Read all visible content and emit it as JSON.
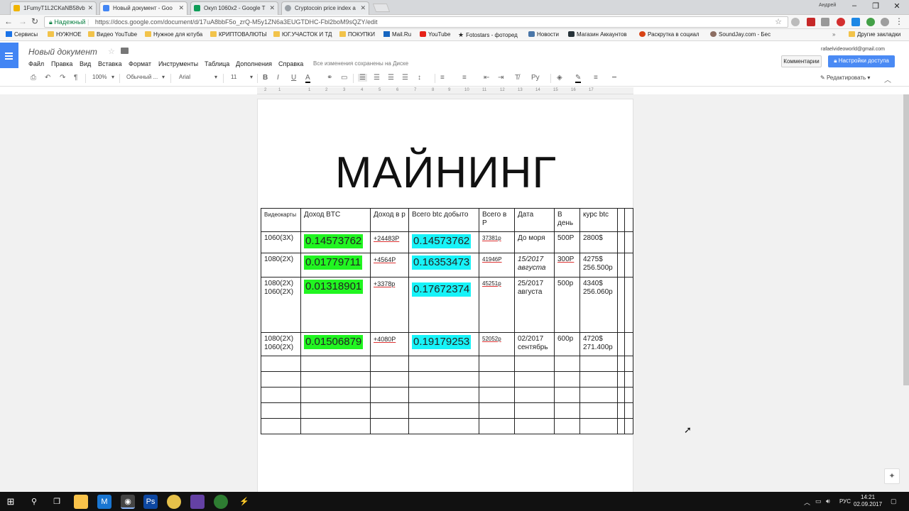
{
  "browser": {
    "tabs": [
      {
        "label": "1FumyT1L2CKaNB58vb",
        "color": "#f0b400"
      },
      {
        "label": "Новый документ - Goo",
        "color": "#4285f4"
      },
      {
        "label": "Окуп 1060x2 - Google T",
        "color": "#0f9d58"
      },
      {
        "label": "Cryptocoin price index a",
        "color": "#9aa0a6"
      }
    ],
    "user_name": "Андрей",
    "secure_label": "Надежный",
    "url": "https://docs.google.com/document/d/17uA8bbF5o_zrQ-M5y1ZN6a3EUGTDHC-Fbl2boM9sQZY/edit"
  },
  "bookmarks": [
    {
      "label": "Сервисы",
      "icon": "apps-icon"
    },
    {
      "label": "НУЖНОЕ",
      "icon": "folder-icon"
    },
    {
      "label": "Видео YouTube",
      "icon": "folder-icon"
    },
    {
      "label": "Нужное для ютуба",
      "icon": "folder-icon"
    },
    {
      "label": "КРИПТОВАЛЮТЫ",
      "icon": "folder-icon"
    },
    {
      "label": "ЮГ.УЧАСТОК И ТД",
      "icon": "folder-icon"
    },
    {
      "label": "ПОКУПКИ",
      "icon": "folder-icon"
    },
    {
      "label": "Mail.Ru",
      "icon": "mail-icon"
    },
    {
      "label": "YouTube",
      "icon": "youtube-icon"
    },
    {
      "label": "Fotostars - фоторед",
      "icon": "star-icon"
    },
    {
      "label": "Новости",
      "icon": "vk-icon"
    },
    {
      "label": "Магазин Аккаунтов",
      "icon": "s-icon"
    },
    {
      "label": "Раскрутка в социал",
      "icon": "promo-icon"
    },
    {
      "label": "SoundJay.com - Бес",
      "icon": "sound-icon"
    },
    {
      "label": "Другие закладки",
      "icon": "folder-icon"
    }
  ],
  "docs": {
    "title": "Новый документ",
    "menus": [
      "Файл",
      "Правка",
      "Вид",
      "Вставка",
      "Формат",
      "Инструменты",
      "Таблица",
      "Дополнения",
      "Справка"
    ],
    "saved_status": "Все изменения сохранены на Диске",
    "account": "rafaelvideoworld@gmail.com",
    "comments_label": "Комментарии",
    "share_label": "Настройки доступа",
    "zoom": "100%",
    "style": "Обычный ...",
    "font": "Arial",
    "font_size": "11",
    "edit_mode": "Редактировать"
  },
  "ruler_ticks": [
    "2",
    "1",
    "1",
    "2",
    "3",
    "4",
    "5",
    "6",
    "7",
    "8",
    "9",
    "10",
    "11",
    "12",
    "13",
    "14",
    "15",
    "16",
    "17"
  ],
  "document": {
    "heading": "МАЙНИНГ",
    "table": {
      "headers": [
        "Видеокарты",
        "Доход BTC",
        "Доход в р",
        "Всего btc добыто",
        "Всего в Р",
        "Дата",
        "В день",
        "курс btc"
      ],
      "rows": [
        {
          "cards": "1060(3X)",
          "btc": "0.14573762",
          "rub": "+24483Р",
          "total_btc": "0.14573762",
          "total_rub": "37381р",
          "date": "До моря",
          "per_day": "500Р",
          "rate": "2800$"
        },
        {
          "cards": "1080(2X)",
          "btc": "0.01779711",
          "rub": "+4564Р",
          "total_btc": "0.16353473",
          "total_rub": "41946Р",
          "date": "15/2017 августа",
          "per_day": "300Р",
          "rate": "4275$ 256.500р"
        },
        {
          "cards": "1080(2X) 1060(2X)",
          "btc": "0.01318901",
          "rub": "+3378р",
          "total_btc": "0.17672374",
          "total_rub": "45251р",
          "date": "25/2017 августа",
          "per_day": "500р",
          "rate": "4340$ 256.060р"
        },
        {
          "cards": "1080(2X) 1060(2X)",
          "btc": "0.01506879",
          "rub": "+4080Р",
          "total_btc": "0.19179253",
          "total_rub": "52052р",
          "date": "02/2017 сентябрь",
          "per_day": "600р",
          "rate": "4720$ 271.400р"
        }
      ]
    }
  },
  "taskbar": {
    "lang": "РУС",
    "time": "14:21",
    "date": "02.09.2017"
  },
  "colors": {
    "btc_highlight": "#21f521",
    "total_highlight": "#17f3f8",
    "share_button": "#4a8af4",
    "docs_blue": "#4285f4"
  }
}
